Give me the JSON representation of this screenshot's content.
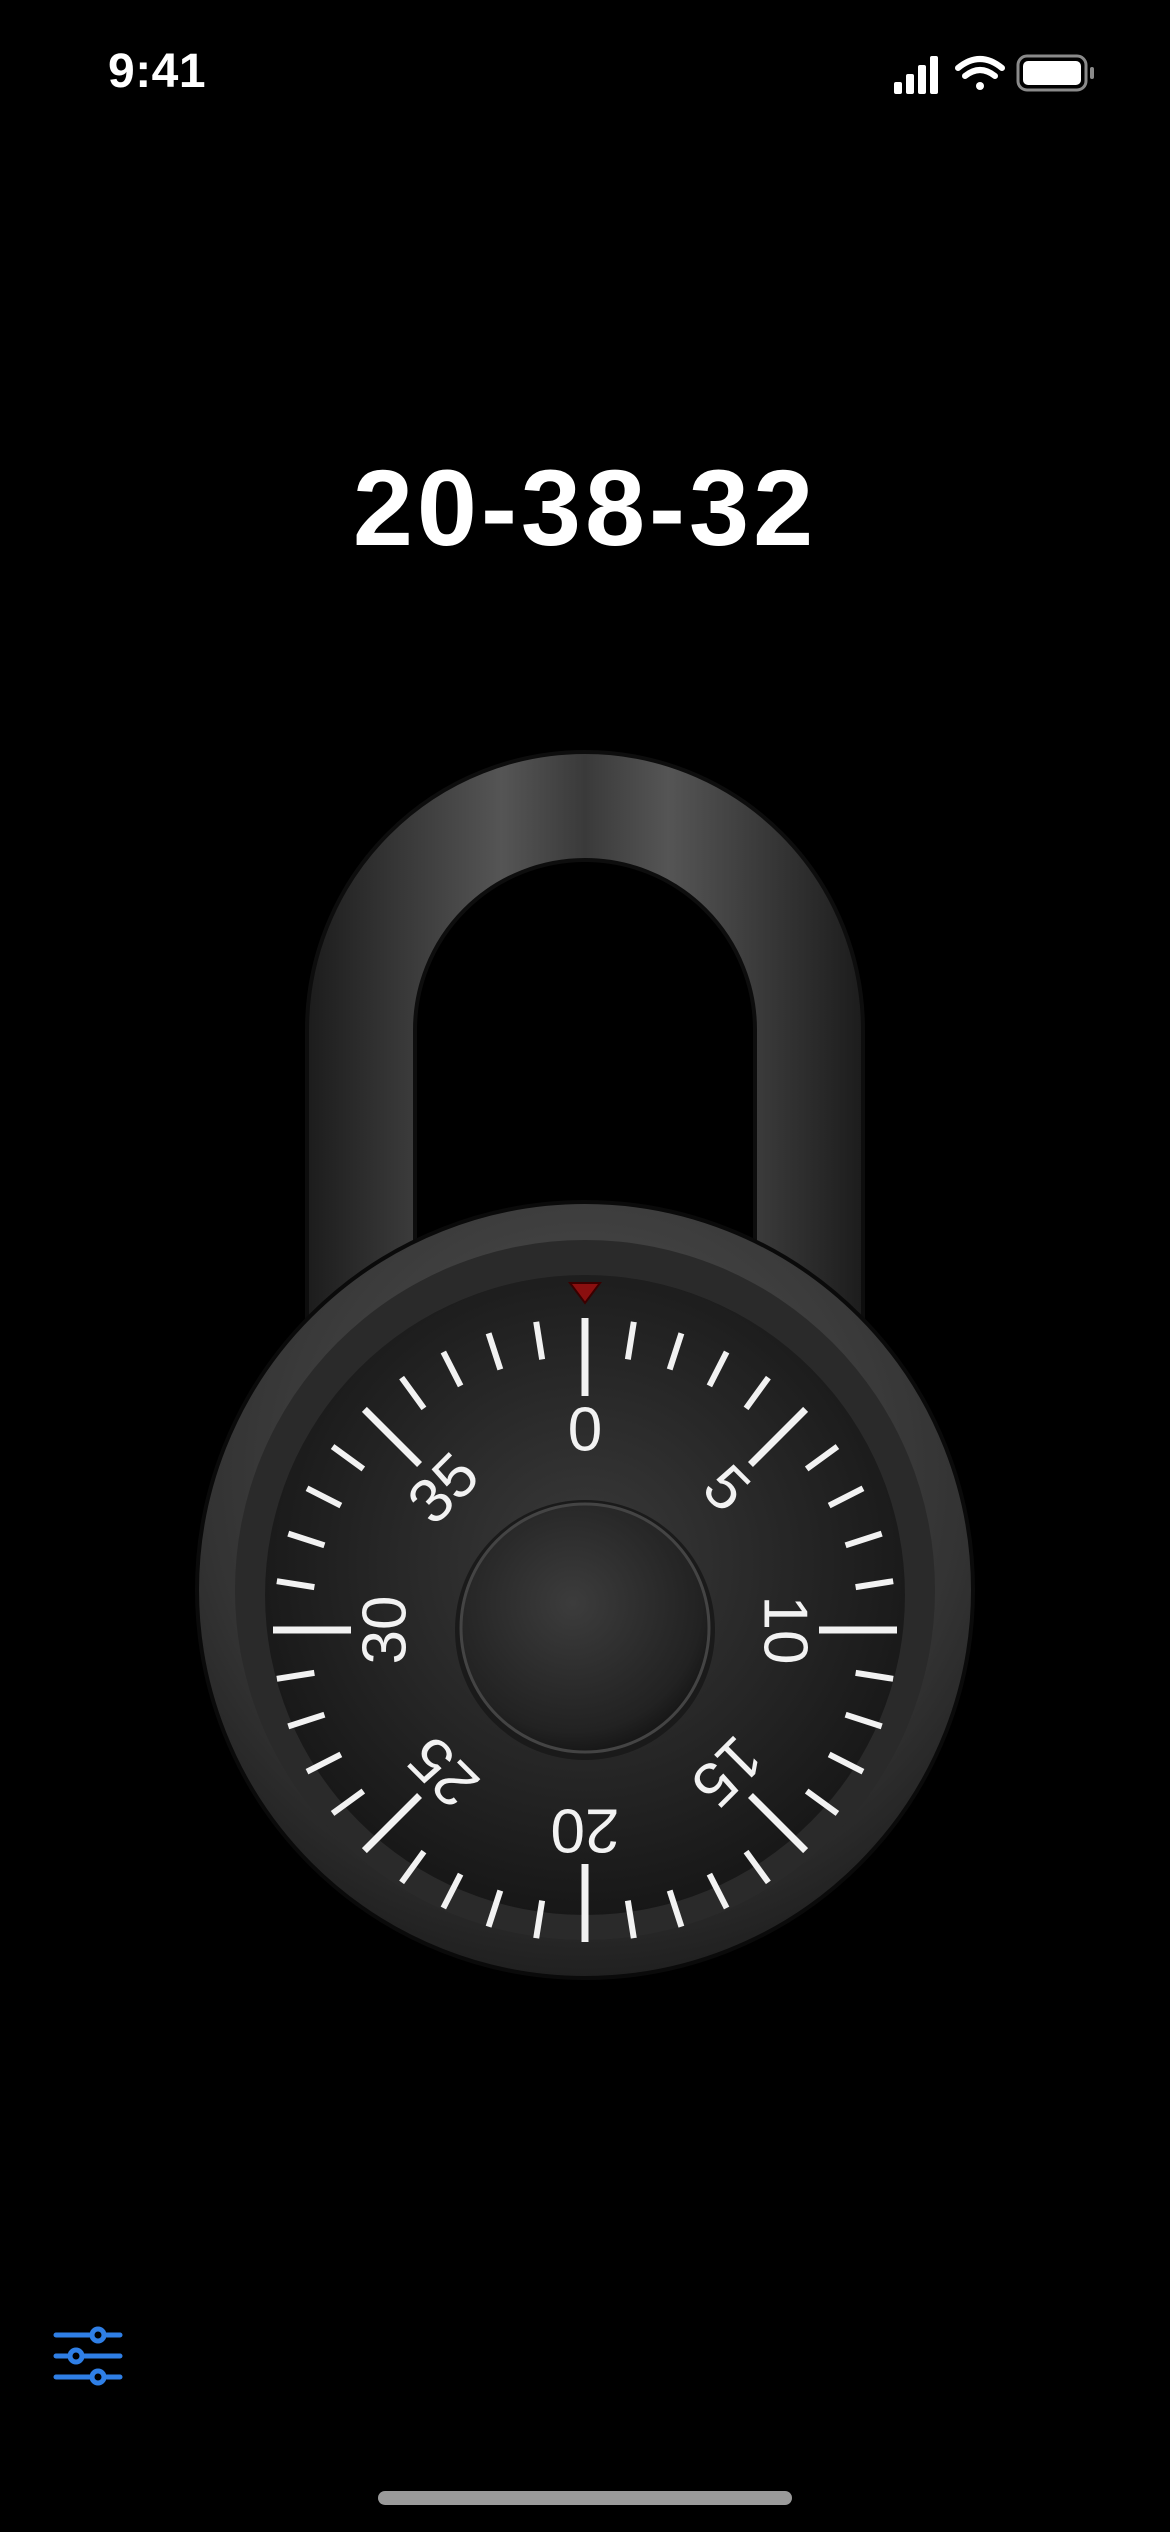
{
  "status_bar": {
    "time": "9:41"
  },
  "combination": "20-38-32",
  "dial": {
    "numbers": [
      "0",
      "5",
      "10",
      "15",
      "20",
      "25",
      "30",
      "35"
    ],
    "max_value": 40,
    "indicator_color": "#a01010"
  },
  "icons": {
    "signal": "cellular-signal-icon",
    "wifi": "wifi-icon",
    "battery": "battery-icon",
    "settings": "sliders-icon"
  },
  "colors": {
    "accent": "#2f7fe6",
    "background": "#000000",
    "text": "#ffffff"
  }
}
